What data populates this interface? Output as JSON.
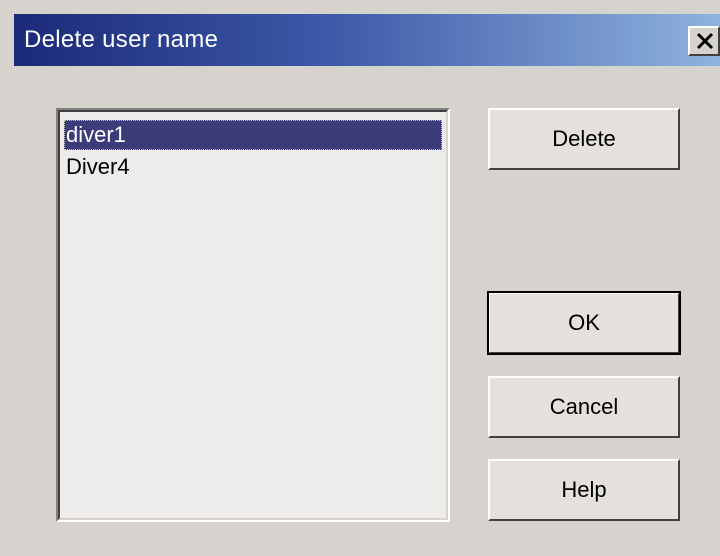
{
  "window": {
    "title": "Delete user name"
  },
  "user_list": {
    "items": [
      {
        "label": "diver1",
        "selected": true
      },
      {
        "label": "Diver4",
        "selected": false
      }
    ]
  },
  "buttons": {
    "delete_label": "Delete",
    "ok_label": "OK",
    "cancel_label": "Cancel",
    "help_label": "Help"
  },
  "icons": {
    "close": "close-icon"
  },
  "colors": {
    "title_gradient_start": "#1b2a78",
    "title_gradient_end": "#8fb3de",
    "dialog_background": "#d6d3ce",
    "selection_background": "#3c3c7a",
    "list_background": "#eeecea"
  }
}
